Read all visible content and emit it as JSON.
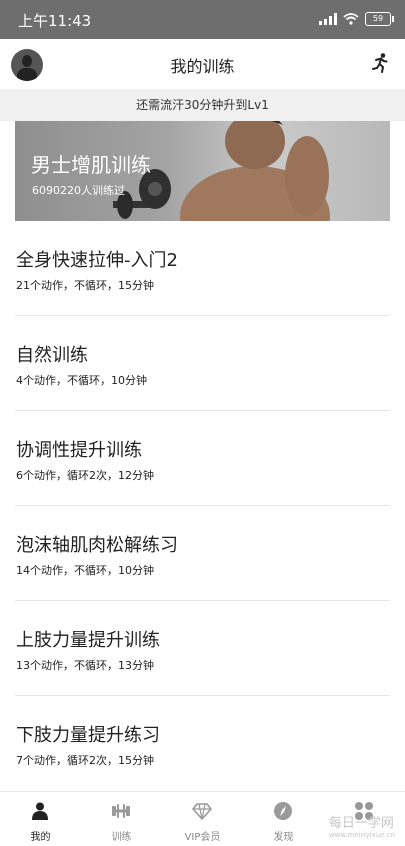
{
  "status_bar": {
    "time": "上午11:43",
    "battery": "59"
  },
  "header": {
    "title": "我的训练",
    "avatar_icon": "user-avatar-icon",
    "right_icon": "running-icon"
  },
  "notice": "还需流汗30分钟升到Lv1",
  "banner": {
    "title": "男士增肌训练",
    "subtitle": "6090220人训练过"
  },
  "workouts": [
    {
      "name": "全身快速拉伸-入门2",
      "meta": "21个动作，不循环，15分钟"
    },
    {
      "name": "自然训练",
      "meta": "4个动作，不循环，10分钟"
    },
    {
      "name": "协调性提升训练",
      "meta": "6个动作，循环2次，12分钟"
    },
    {
      "name": "泡沫轴肌肉松解练习",
      "meta": "14个动作，不循环，10分钟"
    },
    {
      "name": "上肢力量提升训练",
      "meta": "13个动作，不循环，13分钟"
    },
    {
      "name": "下肢力量提升练习",
      "meta": "7个动作，循环2次，15分钟"
    }
  ],
  "tabs": [
    {
      "label": "我的",
      "icon": "person-icon",
      "active": true
    },
    {
      "label": "训练",
      "icon": "dumbbell-icon",
      "active": false
    },
    {
      "label": "VIP会员",
      "icon": "diamond-icon",
      "active": false
    },
    {
      "label": "发现",
      "icon": "compass-icon",
      "active": false
    },
    {
      "label": "",
      "icon": "more-icon",
      "active": false
    }
  ],
  "watermark": {
    "text": "每日一学网",
    "url": "www.meiriyixue.cn"
  }
}
